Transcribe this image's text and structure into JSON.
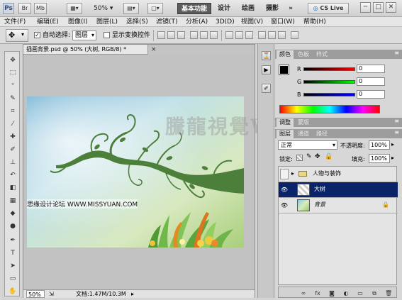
{
  "titlebar": {
    "logo": "Ps",
    "br_btn": "Br",
    "mb_btn": "Mb",
    "zoom": "50%",
    "workspaces": [
      "基本功能",
      "设计",
      "绘画",
      "摄影"
    ],
    "more": "»",
    "cslive": "CS Live",
    "window_buttons": [
      "─",
      "□",
      "✕"
    ]
  },
  "menu": [
    "文件(F)",
    "编辑(E)",
    "图像(I)",
    "图层(L)",
    "选择(S)",
    "滤镜(T)",
    "分析(A)",
    "3D(D)",
    "视图(V)",
    "窗口(W)",
    "帮助(H)"
  ],
  "options": {
    "auto_select_label": "自动选择:",
    "auto_select_value": "图层",
    "show_transform_label": "显示变换控件"
  },
  "document": {
    "tab_title": "插画背景.psd @ 50% (大树, RGB/8) *",
    "close": "×",
    "zoom": "50%",
    "doc_info": "文档:1.47M/10.3M",
    "watermark": "騰龍視覺WWW.TLVI.NET",
    "site_watermark": "思缘设计论坛 WWW.MISSYUAN.COM"
  },
  "color_panel": {
    "tabs": [
      "颜色",
      "色板",
      "样式"
    ],
    "channels": [
      {
        "label": "R",
        "value": "0"
      },
      {
        "label": "G",
        "value": "0"
      },
      {
        "label": "B",
        "value": "0"
      }
    ]
  },
  "adjust_panel": {
    "tabs": [
      "调整",
      "蒙版"
    ]
  },
  "layers_panel": {
    "tabs": [
      "图层",
      "通道",
      "路径"
    ],
    "blend_mode": "正常",
    "opacity_label": "不透明度:",
    "opacity": "100%",
    "lock_label": "锁定:",
    "fill_label": "填充:",
    "fill": "100%",
    "layers": [
      {
        "name": "人物与装饰",
        "kind": "group",
        "selected": false
      },
      {
        "name": "大树",
        "kind": "layer",
        "selected": true
      },
      {
        "name": "背景",
        "kind": "background",
        "selected": false
      }
    ]
  },
  "colors": {
    "selection": "#0a246a",
    "accent_green": "#4c7f3a"
  }
}
